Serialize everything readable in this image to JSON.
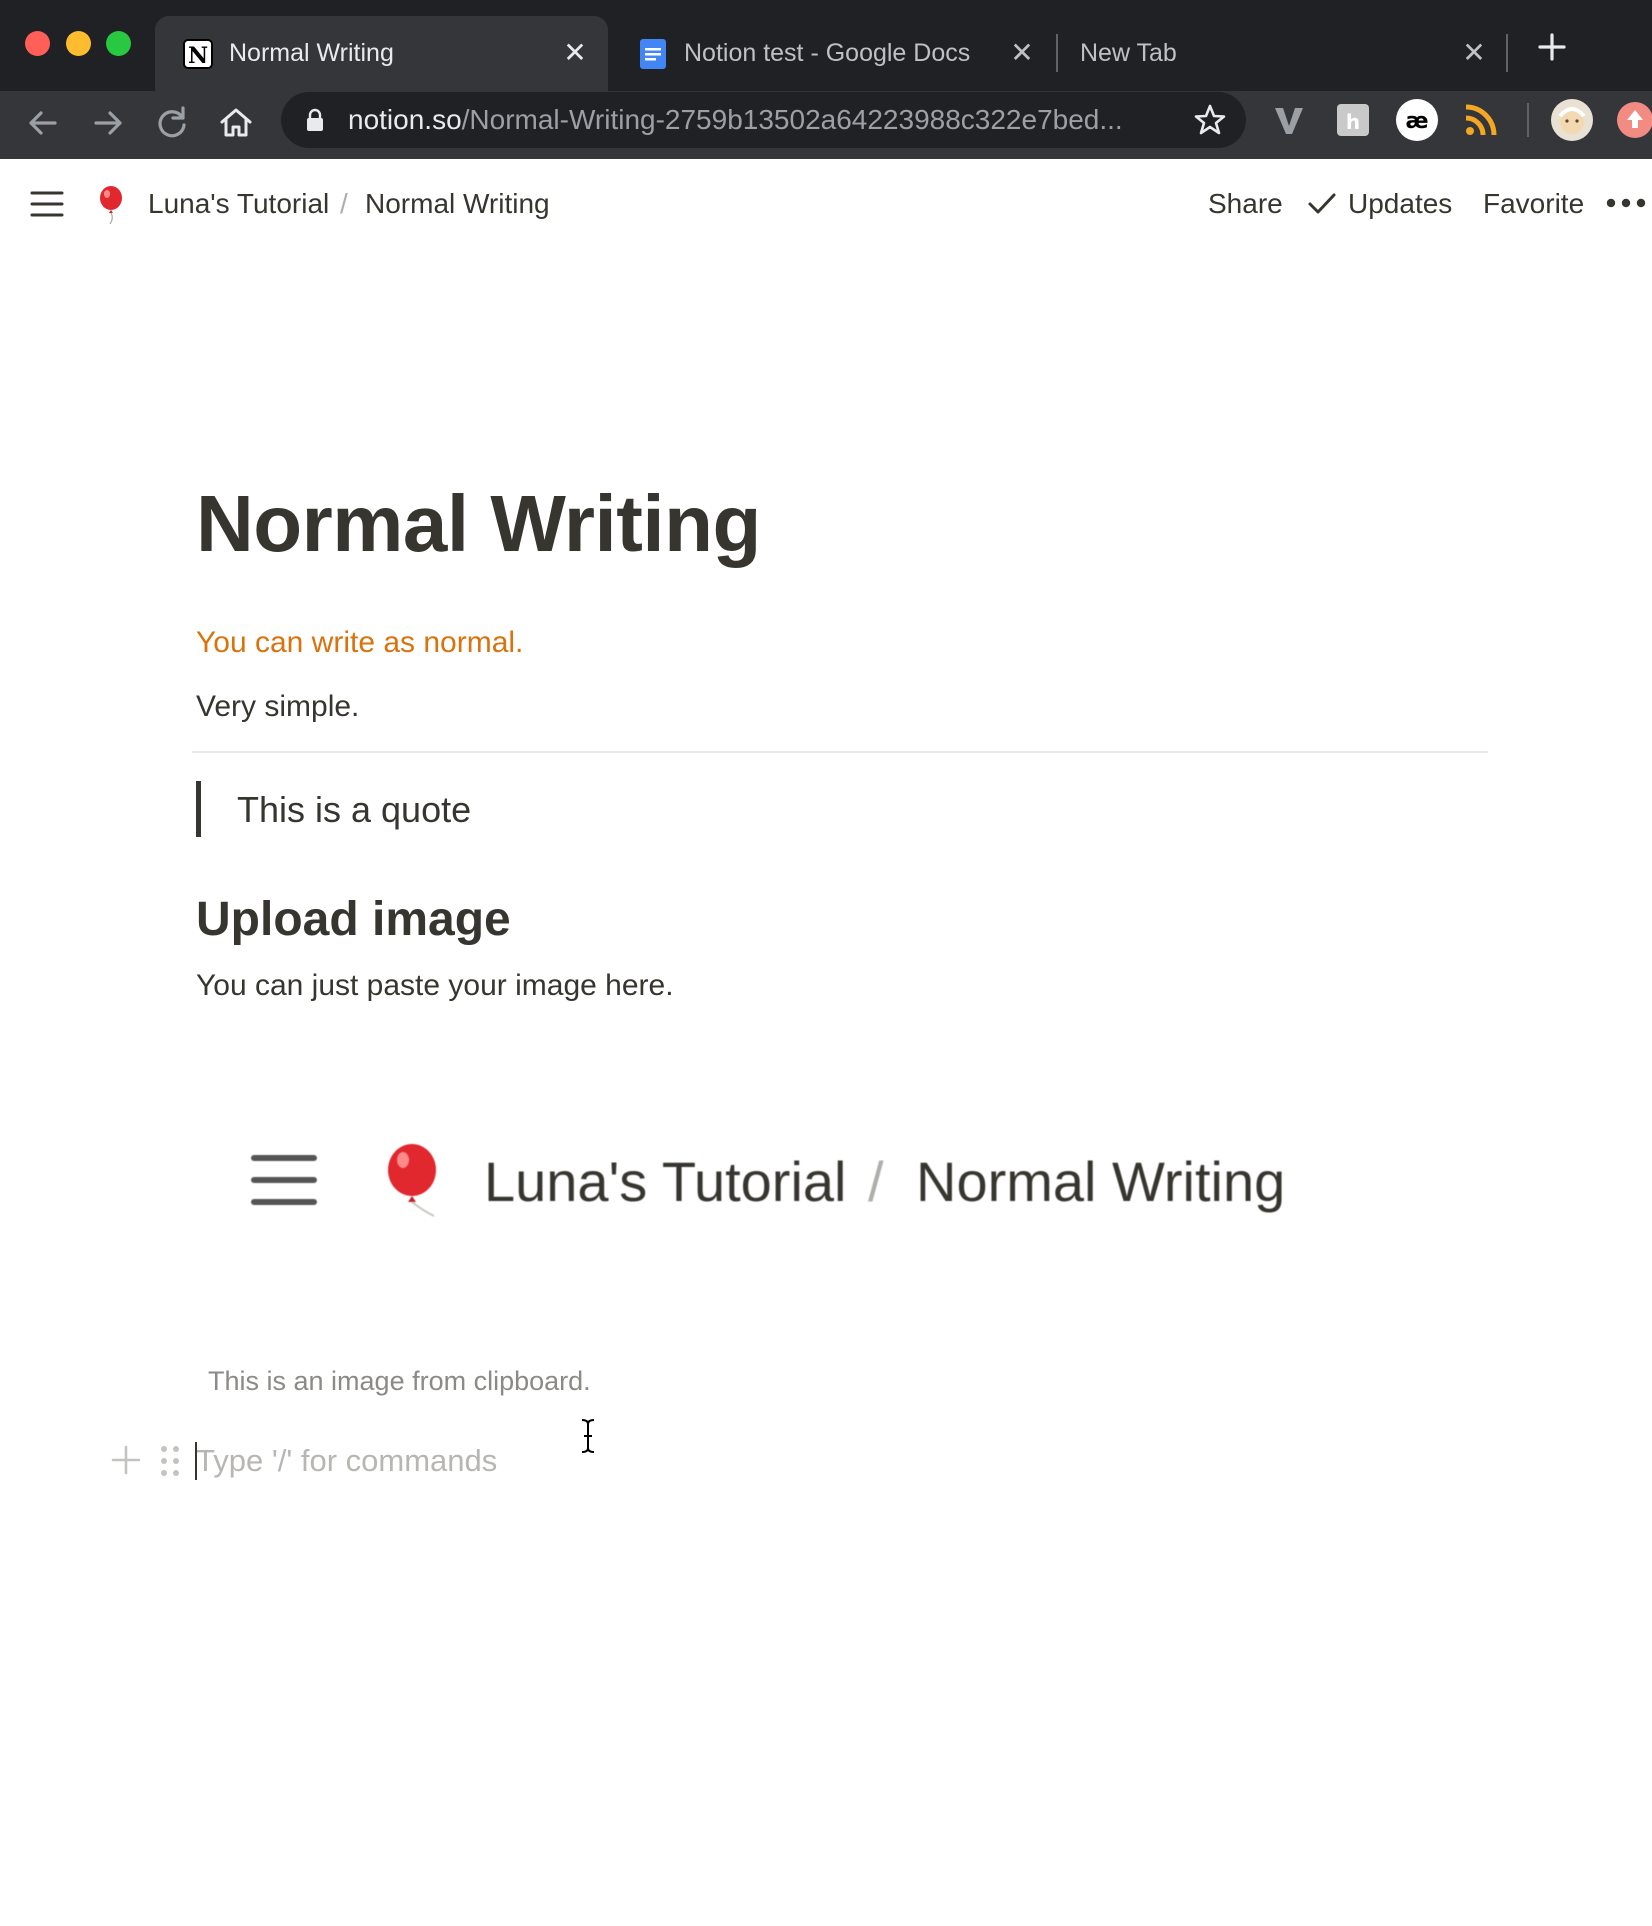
{
  "browser": {
    "tabs": [
      {
        "title": "Normal Writing",
        "favicon": "notion-icon",
        "active": true
      },
      {
        "title": "Notion test - Google Docs",
        "favicon": "google-docs-icon",
        "active": false
      },
      {
        "title": "New Tab",
        "favicon": "",
        "active": false
      }
    ],
    "close_glyph": "✕",
    "url_host": "notion.so",
    "url_path": "/Normal-Writing-2759b13502a64223988c322e7bed...",
    "extensions": [
      "vimeo-v-icon",
      "puzzle-extension-icon",
      "ae-extension-icon",
      "rss-icon",
      "profile-avatar-icon",
      "update-arrow-icon"
    ]
  },
  "notion_topbar": {
    "breadcrumb": [
      "Luna's Tutorial",
      "Normal Writing"
    ],
    "breadcrumb_separator": "/",
    "share": "Share",
    "updates": "Updates",
    "favorite": "Favorite"
  },
  "page": {
    "title": "Normal Writing",
    "para1": "You can write as normal.",
    "para1_color": "#d9730d",
    "para2": "Very simple.",
    "quote": "This is a quote",
    "heading2": "Upload image",
    "para3": "You can just paste your image here.",
    "pasted_image": {
      "crumb1": "Luna's Tutorial",
      "separator": "/",
      "crumb2": "Normal Writing"
    },
    "caption": "This is an image from clipboard.",
    "placeholder": "Type '/' for commands"
  }
}
